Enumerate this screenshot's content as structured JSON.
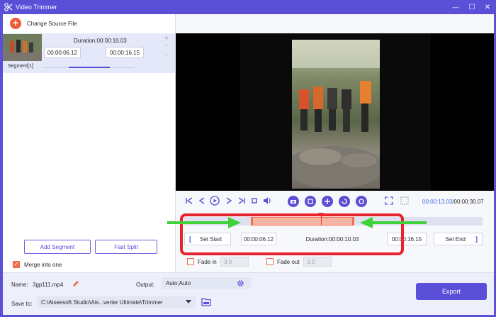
{
  "window": {
    "title": "Video Trimmer",
    "minimize": "—",
    "maximize": "☐",
    "close": "✕"
  },
  "left": {
    "change_source": "Change Source File",
    "segment": {
      "duration": "Duration:00:00:10.03",
      "start": "00:00:06.12",
      "end": "00:00:16.15",
      "label": "Segment[1]",
      "progress_fraction": 0.45
    },
    "add_segment": "Add Segment",
    "fast_split": "Fast Split",
    "merge_label": "Merge into one",
    "merge_checked": true
  },
  "player": {
    "current_time": "00:00:13.03",
    "total_time": "/00:00:30.07"
  },
  "trim": {
    "set_start": "Set Start",
    "start_time": "00:00:06.12",
    "duration": "Duration:00:00:10.03",
    "end_time": "00:00:16.15",
    "set_end": "Set End",
    "bracket_open": "[",
    "bracket_close": "]"
  },
  "fade": {
    "fade_in_label": "Fade in",
    "fade_in_value": "3.0",
    "fade_out_label": "Fade out",
    "fade_out_value": "3.0"
  },
  "bottom": {
    "name_label": "Name:",
    "name_value": "3gp111.mp4",
    "output_label": "Output:",
    "output_value": "Auto;Auto",
    "save_label": "Save to:",
    "save_path": "C:\\Aiseesoft Studio\\Ais...verter Ultimate\\Trimmer",
    "export": "Export"
  },
  "colors": {
    "accent": "#5a4fd6",
    "highlight": "#f07050",
    "annotation_red": "#e8232b",
    "annotation_green": "#3fd23a"
  }
}
